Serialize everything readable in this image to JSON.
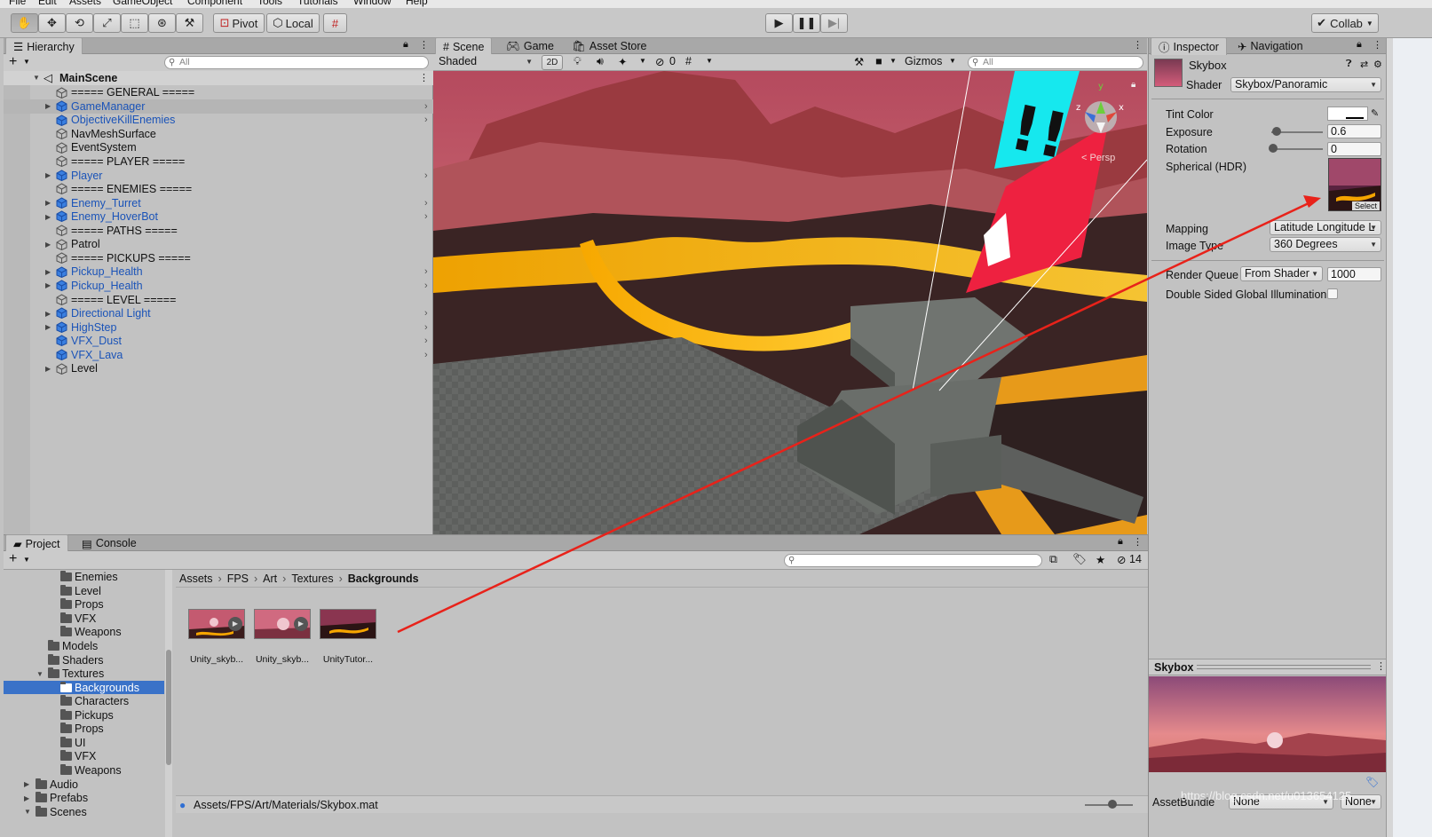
{
  "menu": [
    "File",
    "Edit",
    "Assets",
    "GameObject",
    "Component",
    "Tools",
    "Tutorials",
    "Window",
    "Help"
  ],
  "toolbar": {
    "pivot_label": "Pivot",
    "local_label": "Local",
    "collab_label": "Collab"
  },
  "hierarchy": {
    "tab_label": "Hierarchy",
    "search_placeholder": "All",
    "scene_name": "MainScene",
    "items": [
      {
        "label": "===== GENERAL =====",
        "blue": false,
        "expand": false,
        "chev": false
      },
      {
        "label": "GameManager",
        "blue": true,
        "expand": true,
        "chev": true,
        "selected": true
      },
      {
        "label": "ObjectiveKillEnemies",
        "blue": true,
        "expand": false,
        "chev": true
      },
      {
        "label": "NavMeshSurface",
        "blue": false,
        "expand": false,
        "chev": false
      },
      {
        "label": "EventSystem",
        "blue": false,
        "expand": false,
        "chev": false
      },
      {
        "label": "===== PLAYER =====",
        "blue": false,
        "expand": false,
        "chev": false
      },
      {
        "label": "Player",
        "blue": true,
        "expand": true,
        "chev": true
      },
      {
        "label": "===== ENEMIES =====",
        "blue": false,
        "expand": false,
        "chev": false
      },
      {
        "label": "Enemy_Turret",
        "blue": true,
        "expand": true,
        "chev": true
      },
      {
        "label": "Enemy_HoverBot",
        "blue": true,
        "expand": true,
        "chev": true
      },
      {
        "label": "===== PATHS =====",
        "blue": false,
        "expand": false,
        "chev": false
      },
      {
        "label": "Patrol",
        "blue": false,
        "expand": true,
        "chev": false
      },
      {
        "label": "===== PICKUPS =====",
        "blue": false,
        "expand": false,
        "chev": false
      },
      {
        "label": "Pickup_Health",
        "blue": true,
        "expand": true,
        "chev": true
      },
      {
        "label": "Pickup_Health",
        "blue": true,
        "expand": true,
        "chev": true
      },
      {
        "label": "===== LEVEL =====",
        "blue": false,
        "expand": false,
        "chev": false
      },
      {
        "label": "Directional Light",
        "blue": true,
        "expand": true,
        "chev": true
      },
      {
        "label": "HighStep",
        "blue": true,
        "expand": true,
        "chev": true
      },
      {
        "label": "VFX_Dust",
        "blue": true,
        "expand": false,
        "chev": true
      },
      {
        "label": "VFX_Lava",
        "blue": true,
        "expand": false,
        "chev": true
      },
      {
        "label": "Level",
        "blue": false,
        "expand": true,
        "chev": false
      }
    ]
  },
  "scene": {
    "tabs": [
      "Scene",
      "Game",
      "Asset Store"
    ],
    "shading_mode": "Shaded",
    "mode_2d": "2D",
    "hidden_count": "0",
    "gizmos_label": "Gizmos",
    "search_placeholder": "All",
    "persp_label": "< Persp"
  },
  "inspector": {
    "tabs": [
      "Inspector",
      "Navigation"
    ],
    "material_name": "Skybox",
    "shader_label": "Shader",
    "shader_value": "Skybox/Panoramic",
    "tint_label": "Tint Color",
    "exposure_label": "Exposure",
    "exposure_value": "0.6",
    "rotation_label": "Rotation",
    "rotation_value": "0",
    "spherical_label": "Spherical  (HDR)",
    "select_label": "Select",
    "mapping_label": "Mapping",
    "mapping_value": "Latitude Longitude L",
    "image_type_label": "Image Type",
    "image_type_value": "360 Degrees",
    "render_queue_label": "Render Queue",
    "render_queue_mode": "From Shader",
    "render_queue_value": "1000",
    "double_sided_label": "Double Sided Global Illumination",
    "preview_title": "Skybox",
    "asset_bundle_label": "AssetBundle",
    "asset_bundle_value": "None",
    "asset_bundle_variant": "None"
  },
  "project": {
    "tabs": [
      "Project",
      "Console"
    ],
    "badge_count": "14",
    "breadcrumb": [
      "Assets",
      "FPS",
      "Art",
      "Textures",
      "Backgrounds"
    ],
    "folders": [
      {
        "label": "Enemies",
        "indent": 3,
        "expand": false
      },
      {
        "label": "Level",
        "indent": 3,
        "expand": false
      },
      {
        "label": "Props",
        "indent": 3,
        "expand": false
      },
      {
        "label": "VFX",
        "indent": 3,
        "expand": false
      },
      {
        "label": "Weapons",
        "indent": 3,
        "expand": false
      },
      {
        "label": "Models",
        "indent": 2,
        "expand": false
      },
      {
        "label": "Shaders",
        "indent": 2,
        "expand": false
      },
      {
        "label": "Textures",
        "indent": 2,
        "expand": true
      },
      {
        "label": "Backgrounds",
        "indent": 3,
        "expand": false,
        "selected": true
      },
      {
        "label": "Characters",
        "indent": 3,
        "expand": false
      },
      {
        "label": "Pickups",
        "indent": 3,
        "expand": false
      },
      {
        "label": "Props",
        "indent": 3,
        "expand": false
      },
      {
        "label": "UI",
        "indent": 3,
        "expand": false
      },
      {
        "label": "VFX",
        "indent": 3,
        "expand": false
      },
      {
        "label": "Weapons",
        "indent": 3,
        "expand": false
      },
      {
        "label": "Audio",
        "indent": 1,
        "expand": "closed"
      },
      {
        "label": "Prefabs",
        "indent": 1,
        "expand": "closed"
      },
      {
        "label": "Scenes",
        "indent": 1,
        "expand": true
      }
    ],
    "assets": [
      "Unity_skyb...",
      "Unity_skyb...",
      "UnityTutor..."
    ],
    "status_path": "Assets/FPS/Art/Materials/Skybox.mat"
  },
  "watermark": "https://blog.csdn.net/u013654125",
  "colors": {
    "accent_blue": "#3a72c8",
    "selection_blue": "#3a72c8",
    "prefab_blue": "#1a53b8",
    "annotation_red": "#e8221a"
  }
}
